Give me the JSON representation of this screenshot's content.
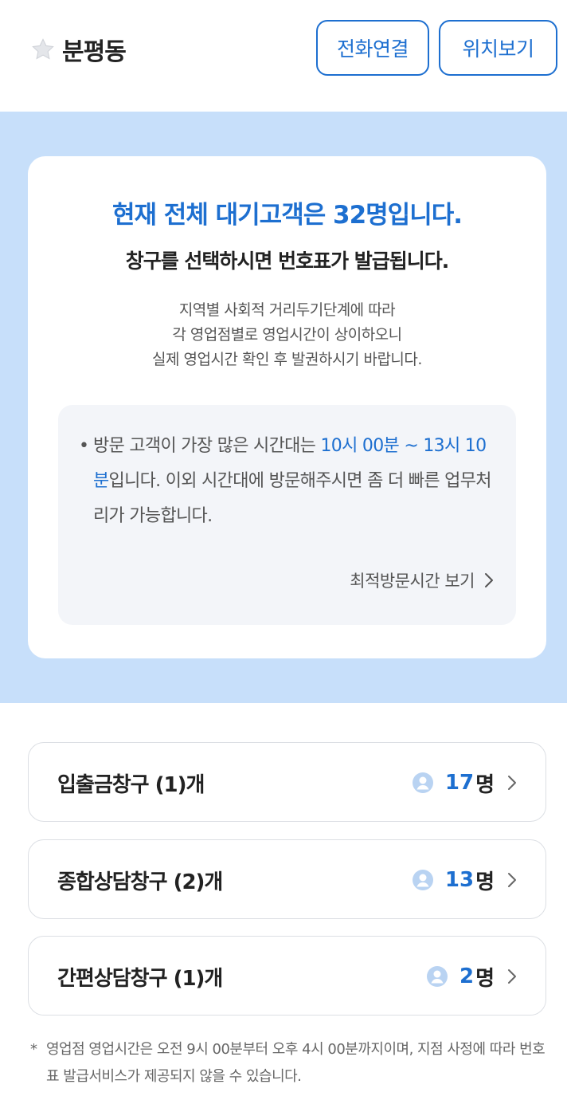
{
  "header": {
    "branch_name": "분평동",
    "call_button": "전화연결",
    "location_button": "위치보기"
  },
  "info": {
    "headline": "현재 전체 대기고객은 32명입니다.",
    "subhead": "창구를 선택하시면 번호표가 발급됩니다.",
    "notice_lines": [
      "지역별 사회적 거리두기단계에 따라",
      "각 영업점별로 영업시간이 상이하오니",
      "실제 영업시간 확인 후 발권하시기 바랍니다."
    ],
    "tip": {
      "bullet": "•",
      "prefix": "방문 고객이 가장 많은 시간대는 ",
      "highlight": "10시 00분 ~ 13시 10분",
      "suffix": "입니다. 이외 시간대에 방문해주시면 좀 더 빠른 업무처리가 가능합니다."
    },
    "best_time_link": "최적방문시간 보기"
  },
  "windows": [
    {
      "label": "입출금창구 (1)개",
      "count": "17",
      "unit": "명"
    },
    {
      "label": "종합상담창구 (2)개",
      "count": "13",
      "unit": "명"
    },
    {
      "label": "간편상담창구 (1)개",
      "count": "2",
      "unit": "명"
    }
  ],
  "footnote": {
    "mark": "*",
    "text": "영업점 영업시간은 오전 9시 00분부터 오후 4시 00분까지이며, 지점 사정에 따라 번호표 발급서비스가 제공되지 않을 수 있습니다."
  },
  "colors": {
    "accent": "#1d6fd0",
    "band": "#c7dffa",
    "tip_bg": "#f3f5f9"
  }
}
